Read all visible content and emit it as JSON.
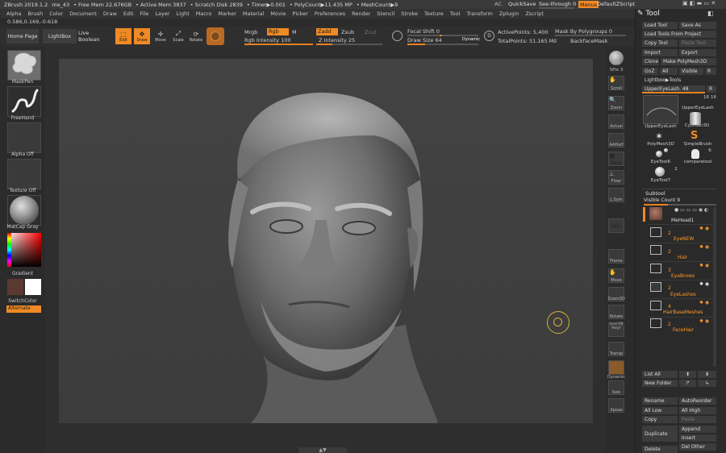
{
  "titlebar": {
    "app": "ZBrush 2019.1.2",
    "doc": "me_43",
    "free_mem": "• Free Mem 22.676GB",
    "active_mem": "• Active Mem 3837",
    "scratch": "• Scratch Disk 2839",
    "timer": "• Timer▶0.001",
    "polycount": "• PolyCount▶11.435 MP",
    "meshcount": "• MeshCount▶9",
    "ac": "AC",
    "quicksave": "QuickSave",
    "seethrough": "See-through  0",
    "menus": "Menus",
    "script": "DefaultZScript"
  },
  "menubar": [
    "Alpha",
    "Brush",
    "Color",
    "Document",
    "Draw",
    "Edit",
    "File",
    "Layer",
    "Light",
    "Macro",
    "Marker",
    "Material",
    "Movie",
    "Picker",
    "Preferences",
    "Render",
    "Stencil",
    "Stroke",
    "Texture",
    "Tool",
    "Transform",
    "Zplugin",
    "Zscript"
  ],
  "coords": "0.586,0.169,-0.618",
  "topshelf": {
    "home": "Home Page",
    "lightbox": "LightBox",
    "live_boolean": "Live Boolean",
    "edit": "Edit",
    "draw": "Draw",
    "move": "Move",
    "scale": "Scale",
    "rotate": "Rotate",
    "mrgb": "Mrgb",
    "rgb": "Rgb",
    "m": "M",
    "rgb_intensity": "Rgb Intensity 100",
    "rgb_intensity_value": 100,
    "zadd": "Zadd",
    "zsub": "Zsub",
    "zcut": "Zcut",
    "z_intensity": "Z Intensity 25",
    "z_intensity_value": 25,
    "focal_shift": "Focal Shift 0",
    "draw_size": "Draw Size 64",
    "dynamic": "Dynamic",
    "active_points": "ActivePoints: 5,400",
    "total_points": "TotalPoints: 51.165 Mil",
    "mask_polygroups": "Mask By Polygroups 0",
    "backface": "BackfaceMask"
  },
  "left": {
    "brush": "MaskPen",
    "stroke": "FreeHand",
    "alpha": "Alpha Off",
    "texture": "Texture Off",
    "material": "MatCap Gray",
    "gradient": "Gradient",
    "switchcolor": "SwitchColor",
    "alternate": "Alternate"
  },
  "right_shelf": [
    "BPR",
    "SPix 3",
    "Scroll",
    "Zoom",
    "Actual",
    "AAHalf",
    "Persp",
    "Floor",
    "L.Sym",
    "Qxyz",
    "Frame",
    "Move",
    "Zoom3D",
    "Rotate",
    "Line Fill PolyF",
    "Transp",
    "Dynamic",
    "Solo",
    "Xpose"
  ],
  "tool": {
    "title": "Tool",
    "load_tool": "Load Tool",
    "save_as": "Save As",
    "load_project": "Load Tools From Project",
    "copy_tool": "Copy Tool",
    "paste_tool": "Paste Tool",
    "import": "Import",
    "export": "Export",
    "clone": "Clone",
    "make_polymesh": "Make PolyMesh3D",
    "goz": "GoZ",
    "all": "All",
    "visible": "Visible",
    "r": "R",
    "lightbox_tools": "Lightbox▶Tools",
    "current": "UpperEyeLash. 48",
    "thumb_count": "16",
    "thumbs": [
      "UpperEyeLash",
      "UpperEyeLash",
      "Cylinder3D",
      "PolyMesh3D",
      "SimpleBrush",
      "EyeTool6",
      "comparetool",
      "EyeTool7"
    ],
    "thumb_badges": [
      "6",
      "2"
    ]
  },
  "subtool": {
    "title": "Subtool",
    "visible_count": "Visible Count 9",
    "items": [
      {
        "num": "",
        "name": "MeHead1"
      },
      {
        "num": "2",
        "name": "EyeNEW"
      },
      {
        "num": "2",
        "name": "Hair"
      },
      {
        "num": "3",
        "name": "EyeBrows"
      },
      {
        "num": "2",
        "name": "EyeLashes"
      },
      {
        "num": "4",
        "name": "HairBaseMeshes"
      },
      {
        "num": "2",
        "name": "FaceHair"
      }
    ],
    "list_all": "List All",
    "new_folder": "New Folder",
    "rename": "Rename",
    "autoreorder": "AutoReorder",
    "all_low": "All Low",
    "all_high": "All High",
    "copy": "Copy",
    "paste": "Paste",
    "duplicate": "Duplicate",
    "append": "Append",
    "insert": "Insert",
    "delete": "Delete",
    "del_other": "Del Other"
  }
}
